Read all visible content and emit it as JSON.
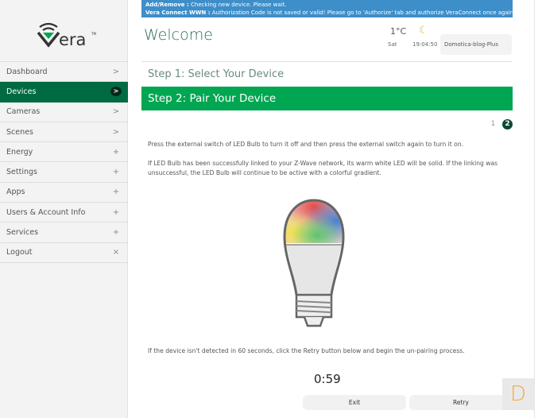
{
  "brand": {
    "logo_text": "vera"
  },
  "sidebar": {
    "items": [
      {
        "label": "Dashboard",
        "icon": ">",
        "icon_name": "chevron-right-icon"
      },
      {
        "label": "Devices",
        "icon": ">",
        "icon_name": "chevron-right-icon",
        "active": true
      },
      {
        "label": "Cameras",
        "icon": ">",
        "icon_name": "chevron-right-icon"
      },
      {
        "label": "Scenes",
        "icon": ">",
        "icon_name": "chevron-right-icon"
      },
      {
        "label": "Energy",
        "icon": "+",
        "icon_name": "plus-icon"
      },
      {
        "label": "Settings",
        "icon": "+",
        "icon_name": "plus-icon"
      },
      {
        "label": "Apps",
        "icon": "+",
        "icon_name": "plus-icon"
      },
      {
        "label": "Users & Account Info",
        "icon": "+",
        "icon_name": "plus-icon"
      },
      {
        "label": "Services",
        "icon": "+",
        "icon_name": "plus-icon"
      },
      {
        "label": "Logout",
        "icon": "×",
        "icon_name": "close-icon"
      }
    ]
  },
  "banner": {
    "line1_label": "Add/Remove :",
    "line1_text": " Checking new device. Please wait.",
    "line2_label": "Vera Connect WWN :",
    "line2_text": " Authorization Code is not saved or valid! Please go to 'Authorize' tab and authorize VeraConnect once again!"
  },
  "header": {
    "title": "Welcome",
    "temperature": "1°C",
    "day": "Sat",
    "time": "19:04:50",
    "account": "Domotica-blog-Plus"
  },
  "wizard": {
    "step1": "Step 1: Select Your Device",
    "step2": "Step 2: Pair Your Device",
    "pages": [
      "1",
      "2"
    ],
    "instruction": "Press the external switch of LED Bulb to turn it off and then press the external switch again to turn it on.",
    "result_info": "If LED Bulb has been successfully linked to your Z-Wave network, its warm white LED will be solid. If the linking was unsuccessful, the LED Bulb will continue to be active with a colorful gradient.",
    "retry_info": "If the device isn't detected in 60 seconds, click the Retry button below and begin the un-pairing process.",
    "countdown": "0:59",
    "exit_label": "Exit",
    "retry_label": "Retry"
  },
  "corner_badge": "D",
  "colors": {
    "accent": "#00a651",
    "nav_active": "#006b43",
    "banner": "#3d8ec9"
  }
}
